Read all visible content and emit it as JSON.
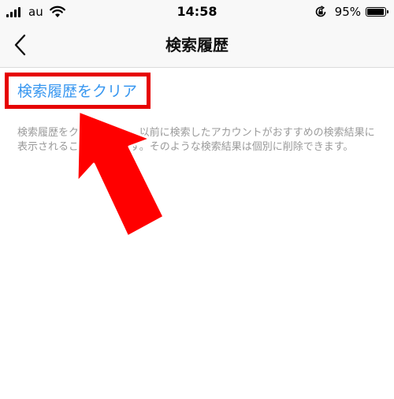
{
  "status_bar": {
    "carrier": "au",
    "time": "14:58",
    "battery_percent": "95%",
    "battery_level": 0.95,
    "icons": [
      "signal-icon",
      "wifi-icon",
      "rotation-lock-icon",
      "battery-icon"
    ]
  },
  "nav": {
    "title": "検索履歴",
    "back_icon": "chevron-left-icon"
  },
  "content": {
    "clear_label": "検索履歴をクリア",
    "description": "検索履歴をクリアしても、以前に検索したアカウントがおすすめの検索結果に表示されることがあります。そのような検索結果は個別に削除できます。"
  },
  "annotation": {
    "highlight_color": "#e60000",
    "arrow_color": "#ff0000"
  },
  "colors": {
    "link": "#3897f0",
    "muted_text": "#9a9a9a"
  }
}
